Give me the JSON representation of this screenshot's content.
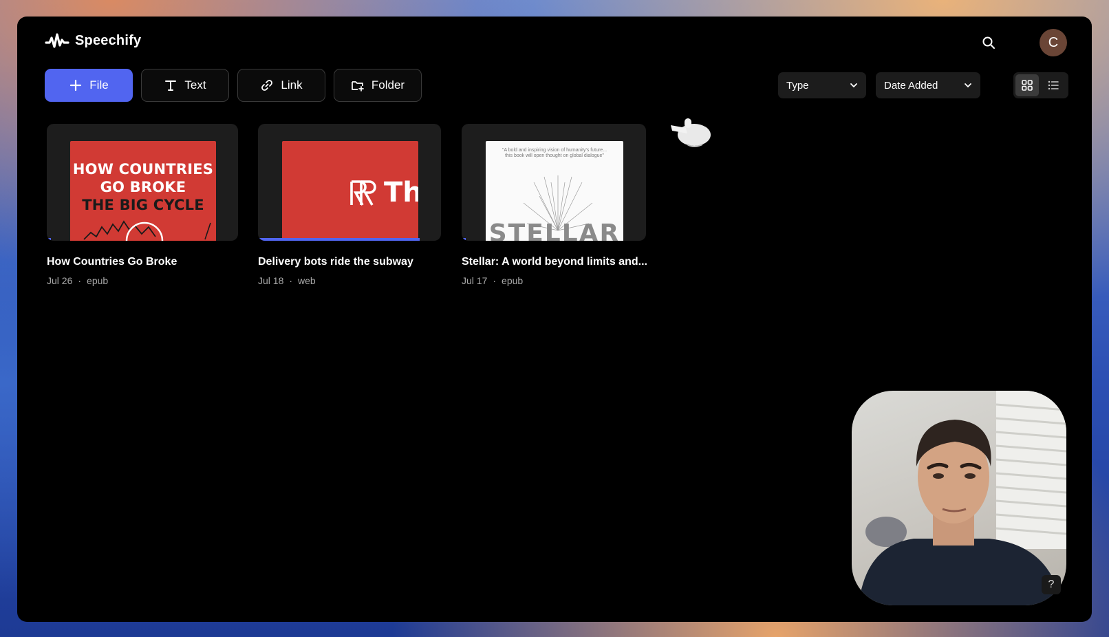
{
  "app": {
    "name": "Speechify"
  },
  "header": {
    "avatar_initial": "C"
  },
  "toolbar": {
    "file_label": "File",
    "text_label": "Text",
    "link_label": "Link",
    "folder_label": "Folder",
    "type_filter": "Type",
    "sort_filter": "Date Added",
    "view_mode": "grid"
  },
  "library": {
    "items": [
      {
        "title": "How Countries Go Broke",
        "date": "Jul 26",
        "format": "epub",
        "cover_lines": [
          "HOW COUNTRIES",
          "GO BROKE",
          "THE BIG CYCLE"
        ],
        "progress": 0.02
      },
      {
        "title": "Delivery bots ride the subway",
        "date": "Jul 18",
        "format": "web",
        "cover_text": "The",
        "progress": 1.0
      },
      {
        "title": "Stellar: A world beyond limits and...",
        "date": "Jul 17",
        "format": "epub",
        "cover_quote": "\"A bold and inspiring vision of humanity's future... this book will open thought on global dialogue\"",
        "cover_title": "STELLAR",
        "progress": 0.02
      }
    ]
  },
  "help": {
    "label": "?"
  },
  "colors": {
    "accent": "#5165f0",
    "cover_red": "#d13a34"
  }
}
